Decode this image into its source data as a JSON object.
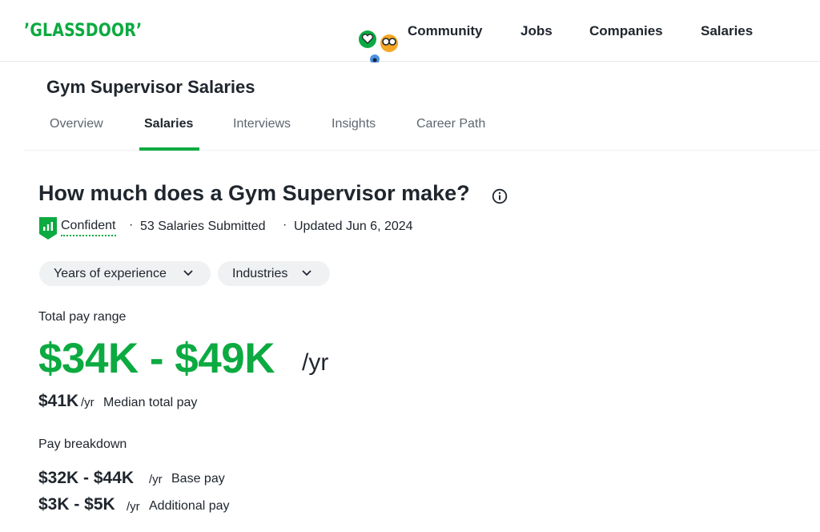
{
  "header": {
    "logo_text": "’GLASSDOOR’",
    "nav": [
      "Community",
      "Jobs",
      "Companies",
      "Salaries"
    ]
  },
  "occupation": {
    "title": "Gym Supervisor Salaries",
    "tabs": [
      "Overview",
      "Salaries",
      "Interviews",
      "Insights",
      "Career Path"
    ],
    "active_tab": "Salaries"
  },
  "main": {
    "heading": "How much does a Gym Supervisor make?",
    "confidence": "Confident",
    "submitted": "53 Salaries Submitted",
    "updated": "Updated Jun 6, 2024",
    "separator": "·",
    "filters": [
      "Years of experience",
      "Industries"
    ],
    "total_pay_label": "Total pay range",
    "total_range": "$34K - $49K",
    "total_unit": "/yr",
    "median_value": "$41K",
    "median_unit": "/yr",
    "median_label": "Median total pay",
    "breakdown_label": "Pay breakdown",
    "base_range": "$32K - $44K",
    "base_unit": "/yr",
    "base_label": "Base pay",
    "additional_range": "$3K - $5K",
    "additional_unit": "/yr",
    "additional_label": "Additional pay"
  },
  "colors": {
    "brand_green": "#0caa41",
    "text": "#20262e",
    "muted": "#5e6670",
    "chip_bg": "#eff1f3"
  },
  "icons": [
    "mascot-icons",
    "info-icon",
    "confidence-badge-icon",
    "chevron-down-icon"
  ]
}
